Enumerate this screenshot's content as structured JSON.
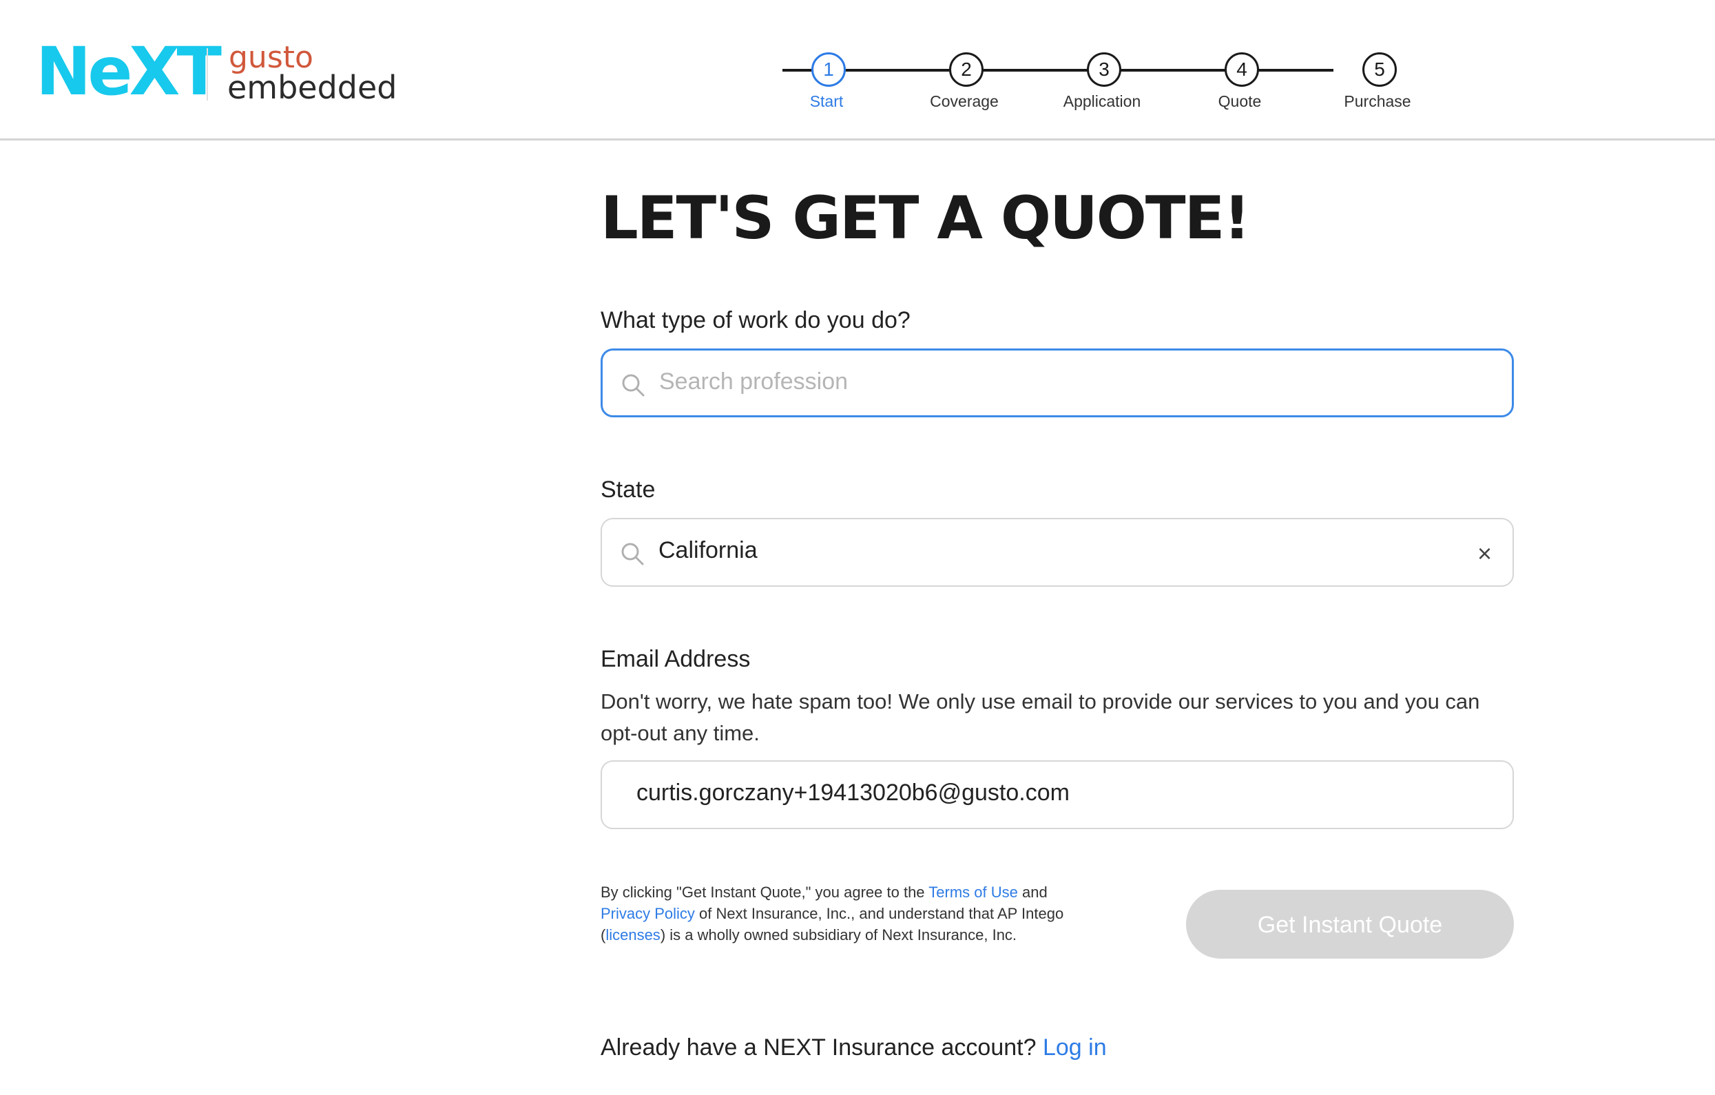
{
  "brand": {
    "next": "NeXT",
    "gusto": "gusto",
    "embedded": "embedded"
  },
  "steps": [
    {
      "num": "1",
      "label": "Start",
      "active": true
    },
    {
      "num": "2",
      "label": "Coverage",
      "active": false
    },
    {
      "num": "3",
      "label": "Application",
      "active": false
    },
    {
      "num": "4",
      "label": "Quote",
      "active": false
    },
    {
      "num": "5",
      "label": "Purchase",
      "active": false
    }
  ],
  "page": {
    "title": "LET'S GET A QUOTE!"
  },
  "work": {
    "label": "What type of work do you do?",
    "placeholder": "Search profession",
    "value": ""
  },
  "state": {
    "label": "State",
    "value": "California",
    "clear_icon": "×"
  },
  "email": {
    "label": "Email Address",
    "helper": "Don't worry, we hate spam too! We only use email to provide our services to you and you can opt-out any time.",
    "value": "curtis.gorczany+19413020b6@gusto.com"
  },
  "legal": {
    "part1": "By clicking \"Get Instant Quote,\" you agree to the ",
    "terms_link": "Terms of Use",
    "part2": " and ",
    "privacy_link": "Privacy Policy",
    "part3": " of Next Insurance, Inc., and understand that AP Intego (",
    "licenses_link": "licenses",
    "part4": ") is a wholly owned subsidiary of Next Insurance, Inc."
  },
  "cta": {
    "label": "Get Instant Quote"
  },
  "login": {
    "prompt": "Already have a NEXT Insurance account? ",
    "link": "Log in"
  },
  "colors": {
    "accent": "#2d7be5",
    "next_brand": "#17c9ec",
    "gusto_brand": "#d1583b",
    "disabled_button": "#d6d6d6"
  }
}
